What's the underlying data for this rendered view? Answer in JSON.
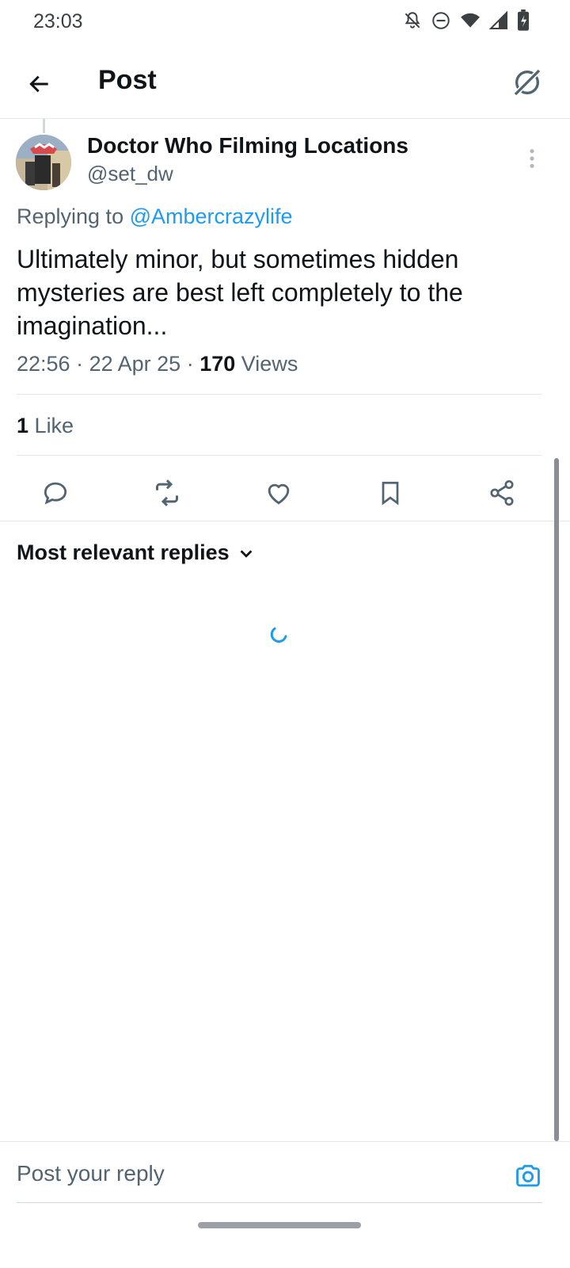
{
  "status_bar": {
    "time": "23:03",
    "icons": [
      "bell-off-icon",
      "do-not-disturb-icon",
      "wifi-icon",
      "cell-signal-icon",
      "battery-charging-icon"
    ]
  },
  "app_bar": {
    "title": "Post",
    "back_icon": "arrow-left-icon",
    "grok_icon": "grok-icon"
  },
  "post": {
    "author_name": "Doctor Who Filming Locations",
    "author_handle": "@set_dw",
    "replying_prefix": "Replying to",
    "replying_to": "@Ambercrazylife",
    "text": "Ultimately minor, but sometimes hidden mysteries are best left completely to the imagination...",
    "time": "22:56",
    "date": "22 Apr 25",
    "views_count": "170",
    "views_label": "Views",
    "likes_count": "1",
    "likes_label": "Like"
  },
  "actions": [
    "reply-icon",
    "repost-icon",
    "like-icon",
    "bookmark-icon",
    "share-icon"
  ],
  "replies": {
    "sort_label": "Most relevant replies"
  },
  "reply_bar": {
    "placeholder": "Post your reply"
  },
  "colors": {
    "accent": "#1d9bf0",
    "text_primary": "#0f1419",
    "text_secondary": "#536471",
    "divider": "#e6e9eb"
  }
}
